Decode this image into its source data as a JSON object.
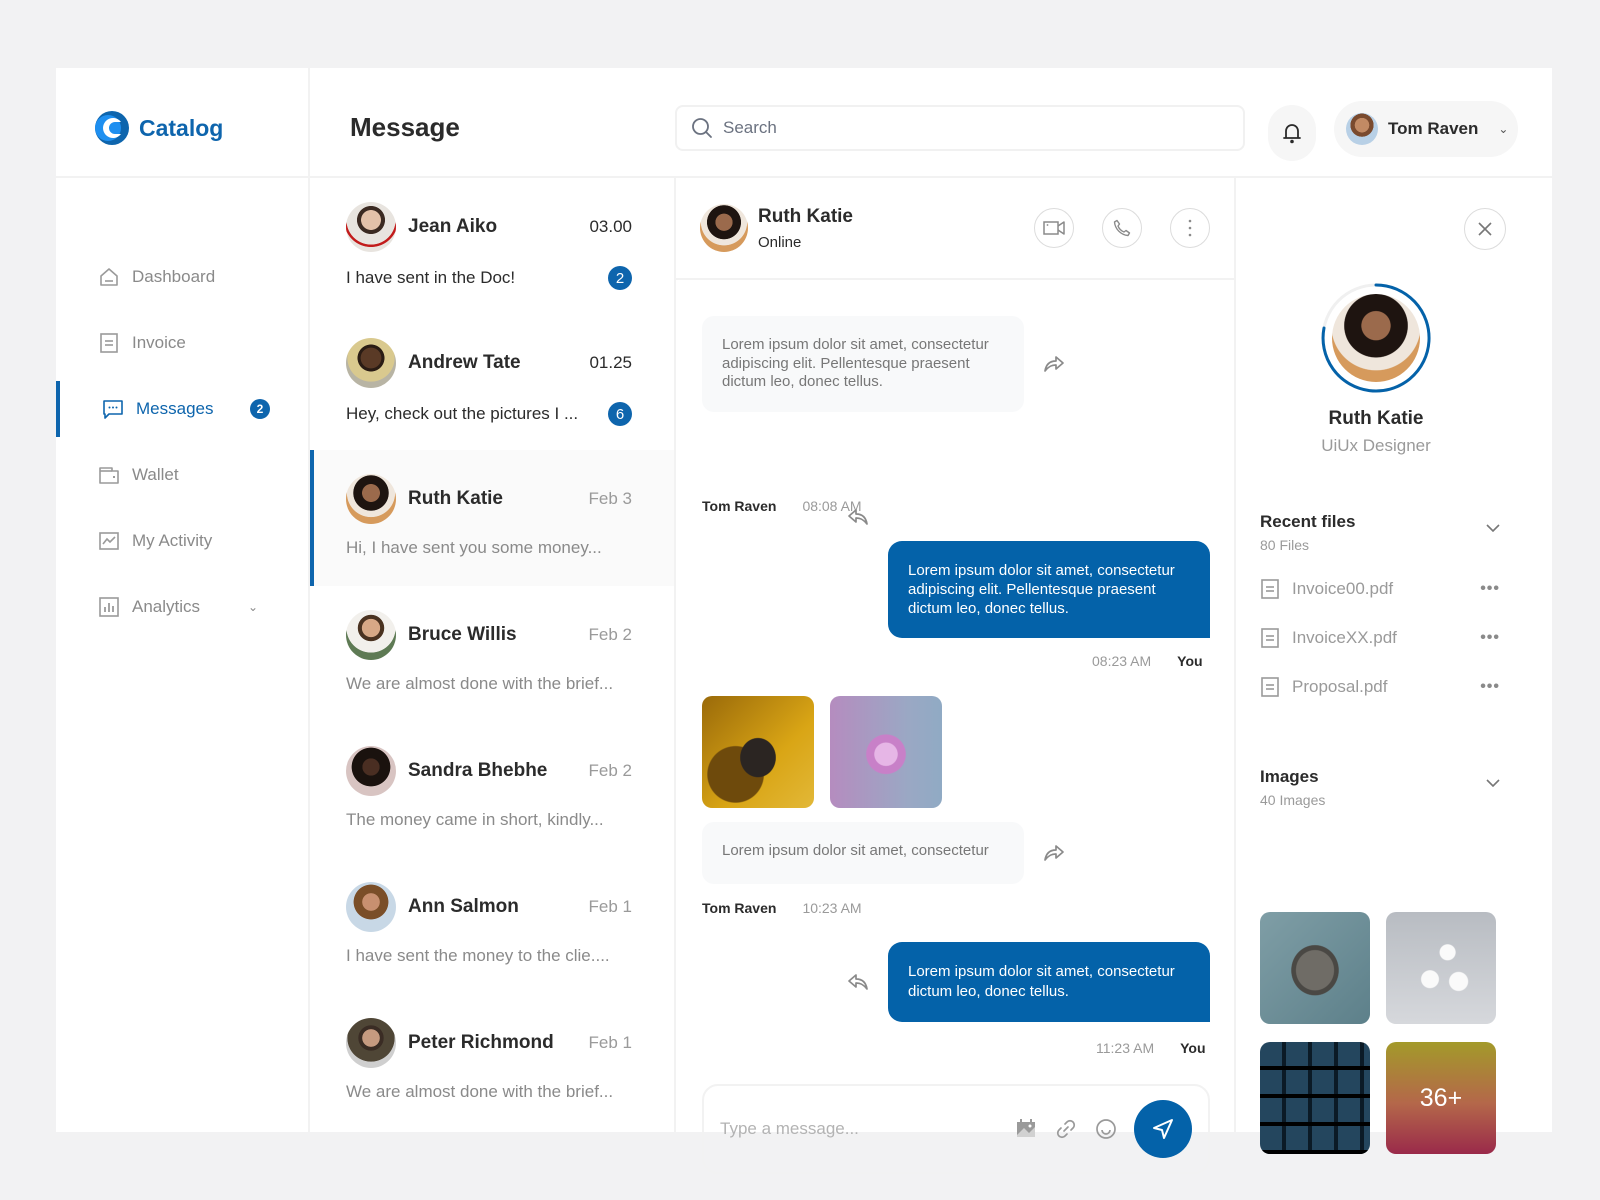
{
  "app": {
    "brand": "Catalog",
    "page_title": "Message"
  },
  "colors": {
    "accent": "#0462a9",
    "brand": "#0e65ad",
    "muted_text": "#9a9a9a",
    "incoming_bubble": "#f8f9fa"
  },
  "header": {
    "search_placeholder": "Search",
    "user": {
      "name": "Tom Raven"
    }
  },
  "sidebar": {
    "items": [
      {
        "label": "Dashboard",
        "icon": "home-icon",
        "active": false
      },
      {
        "label": "Invoice",
        "icon": "invoice-icon",
        "active": false
      },
      {
        "label": "Messages",
        "icon": "chat-icon",
        "active": true,
        "badge": "2"
      },
      {
        "label": "Wallet",
        "icon": "wallet-icon",
        "active": false
      },
      {
        "label": "My Activity",
        "icon": "activity-icon",
        "active": false
      },
      {
        "label": "Analytics",
        "icon": "analytics-icon",
        "active": false,
        "has_submenu": true
      }
    ]
  },
  "chats": [
    {
      "name": "Jean Aiko",
      "time": "03.00",
      "preview": "I have sent in the Doc!",
      "unread": "2",
      "active": false
    },
    {
      "name": "Andrew Tate",
      "time": "01.25",
      "preview": "Hey, check out the pictures I ...",
      "unread": "6",
      "active": false
    },
    {
      "name": "Ruth Katie",
      "time": "Feb 3",
      "preview": "Hi, I have sent you some money...",
      "active": true
    },
    {
      "name": "Bruce Willis",
      "time": "Feb 2",
      "preview": "We are almost done with the brief...",
      "active": false
    },
    {
      "name": "Sandra Bhebhe",
      "time": "Feb 2",
      "preview": "The money came in short, kindly...",
      "active": false
    },
    {
      "name": "Ann Salmon",
      "time": "Feb 1",
      "preview": "I have sent the money to the clie....",
      "active": false
    },
    {
      "name": "Peter Richmond",
      "time": "Feb 1",
      "preview": "We are almost done with the brief...",
      "active": false
    }
  ],
  "conversation": {
    "contact_name": "Ruth Katie",
    "status": "Online",
    "messages": [
      {
        "direction": "in",
        "text": "Lorem ipsum dolor sit amet, consectetur adipiscing elit. Pellentesque praesent dictum leo, donec tellus.",
        "sender": "Tom Raven",
        "time": "08:08 AM"
      },
      {
        "direction": "out",
        "text": "Lorem ipsum dolor sit amet, consectetur adipiscing elit. Pellentesque praesent dictum leo, donec tellus.",
        "sender": "You",
        "time": "08:23 AM"
      },
      {
        "direction": "in",
        "attachments": [
          "cupcake-liner-image",
          "pink-blob-image"
        ],
        "text": "Lorem ipsum dolor sit amet, consectetur",
        "sender": "Tom Raven",
        "time": "10:23 AM"
      },
      {
        "direction": "out",
        "text": "Lorem ipsum dolor sit amet, consectetur dictum leo, donec tellus.",
        "sender": "You",
        "time": "11:23 AM"
      }
    ],
    "composer_placeholder": "Type a message..."
  },
  "profile": {
    "name": "Ruth Katie",
    "role": "UiUx Designer",
    "recent_files": {
      "title": "Recent files",
      "count_label": "80 Files",
      "files": [
        "Invoice00.pdf",
        "InvoiceXX.pdf",
        "Proposal.pdf"
      ]
    },
    "images": {
      "title": "Images",
      "count_label": "40 Images",
      "tiles": [
        "console-image",
        "dice-image",
        "blue-grid-image",
        "popsicle-image"
      ],
      "more_label": "36+"
    }
  }
}
